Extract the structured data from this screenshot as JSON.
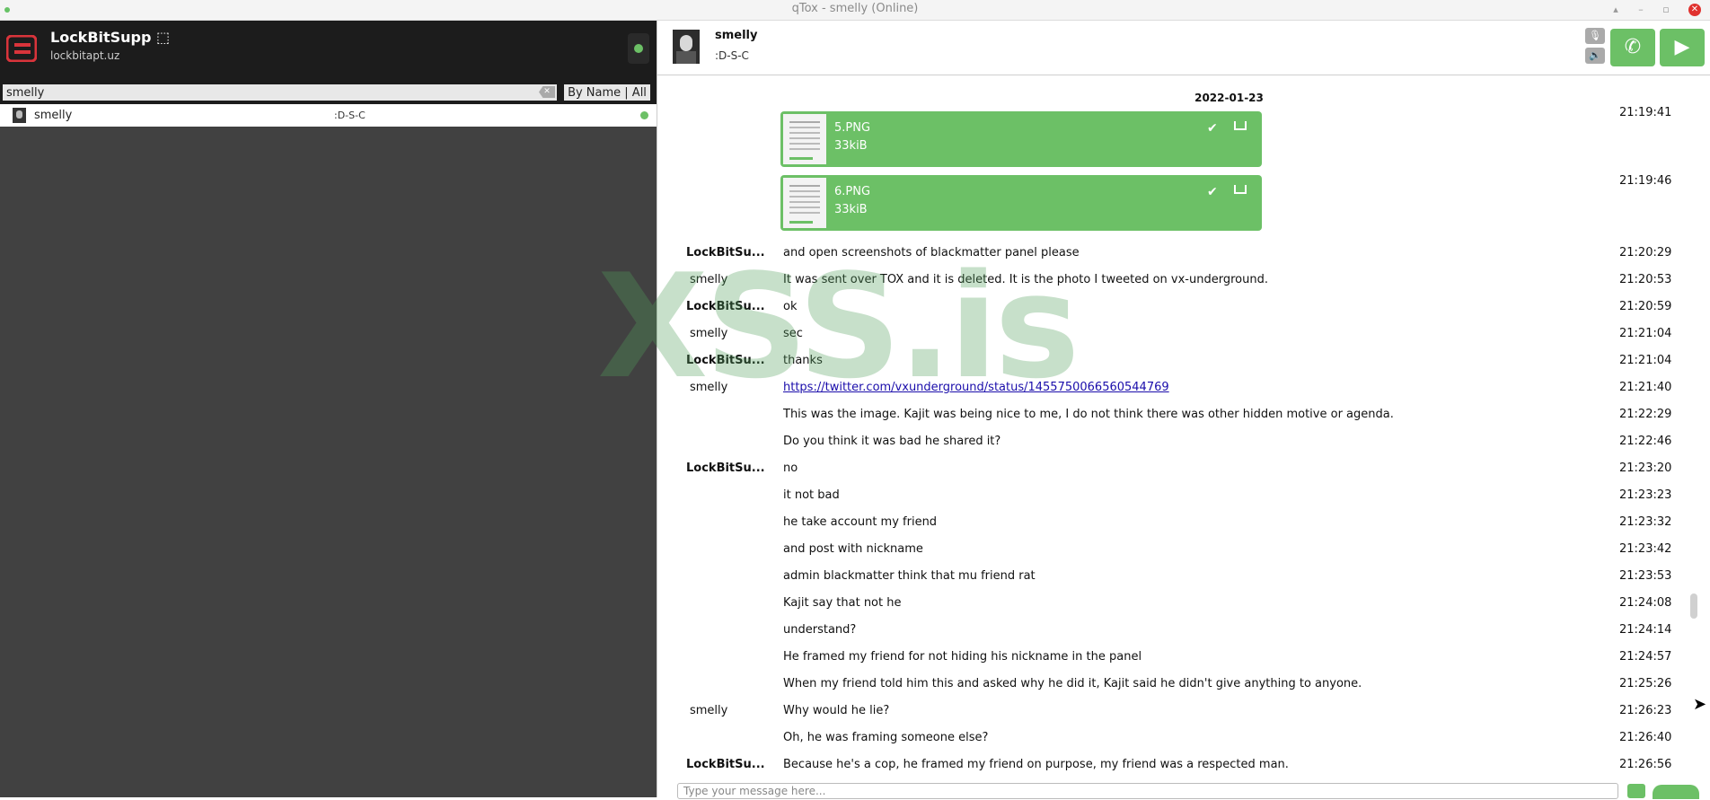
{
  "window": {
    "title": "qTox - smelly (Online)"
  },
  "user": {
    "name": "LockBitSupp ⬚",
    "status": "lockbitapt.uz"
  },
  "search": {
    "value": "smelly",
    "filter_label": "By Name | All"
  },
  "friends": [
    {
      "name": "smelly",
      "status": ":D-S-C"
    }
  ],
  "chat": {
    "contact_name": "smelly",
    "contact_status": ":D-S-C",
    "date": "2022-01-23",
    "files": [
      {
        "name": "5.PNG",
        "size": "33kiB",
        "time": "21:19:41"
      },
      {
        "name": "6.PNG",
        "size": "33kiB",
        "time": "21:19:46"
      }
    ],
    "messages": [
      {
        "author": "LockBitSu...",
        "text": "and open screenshots of blackmatter panel please",
        "time": "21:20:29"
      },
      {
        "author": "smelly",
        "text": "It was sent over TOX and it is deleted. It is the photo I tweeted on vx-underground.",
        "time": "21:20:53"
      },
      {
        "author": "LockBitSu...",
        "text": "ok",
        "time": "21:20:59"
      },
      {
        "author": "smelly",
        "text": "sec",
        "time": "21:21:04"
      },
      {
        "author": "LockBitSu...",
        "text": "thanks",
        "time": "21:21:04"
      },
      {
        "author": "smelly",
        "text": "https://twitter.com/vxunderground/status/1455750066560544769",
        "time": "21:21:40"
      },
      {
        "author": "",
        "text": "This was the image. Kajit was being nice to me, I do not think there was other hidden motive or agenda.",
        "time": "21:22:29"
      },
      {
        "author": "",
        "text": "Do you think it was bad he shared it?",
        "time": "21:22:46"
      },
      {
        "author": "LockBitSu...",
        "text": "no",
        "time": "21:23:20"
      },
      {
        "author": "",
        "text": "it not bad",
        "time": "21:23:23"
      },
      {
        "author": "",
        "text": "he take account my friend",
        "time": "21:23:32"
      },
      {
        "author": "",
        "text": "and post with nickname",
        "time": "21:23:42"
      },
      {
        "author": "",
        "text": "admin blackmatter think that mu friend rat",
        "time": "21:23:53"
      },
      {
        "author": "",
        "text": "Kajit say that not he",
        "time": "21:24:08"
      },
      {
        "author": "",
        "text": "understand?",
        "time": "21:24:14"
      },
      {
        "author": "",
        "text": "He framed my friend for not hiding his nickname in the panel",
        "time": "21:24:57"
      },
      {
        "author": "",
        "text": "When my friend told him this and asked why he did it, Kajit said he didn't give anything to anyone.",
        "time": "21:25:26"
      },
      {
        "author": "smelly",
        "text": "Why would he lie?",
        "time": "21:26:23"
      },
      {
        "author": "",
        "text": "Oh, he was framing someone else?",
        "time": "21:26:40"
      },
      {
        "author": "LockBitSu...",
        "text": "Because he's a cop, he framed my friend on purpose, my friend was a respected man.",
        "time": "21:26:56"
      }
    ],
    "input_placeholder": "Type your message here..."
  },
  "watermark": "XSS.is",
  "colors": {
    "accent": "#6cc066",
    "sidebar": "#414141",
    "header": "#1c1c1c",
    "danger": "#e0322f"
  }
}
